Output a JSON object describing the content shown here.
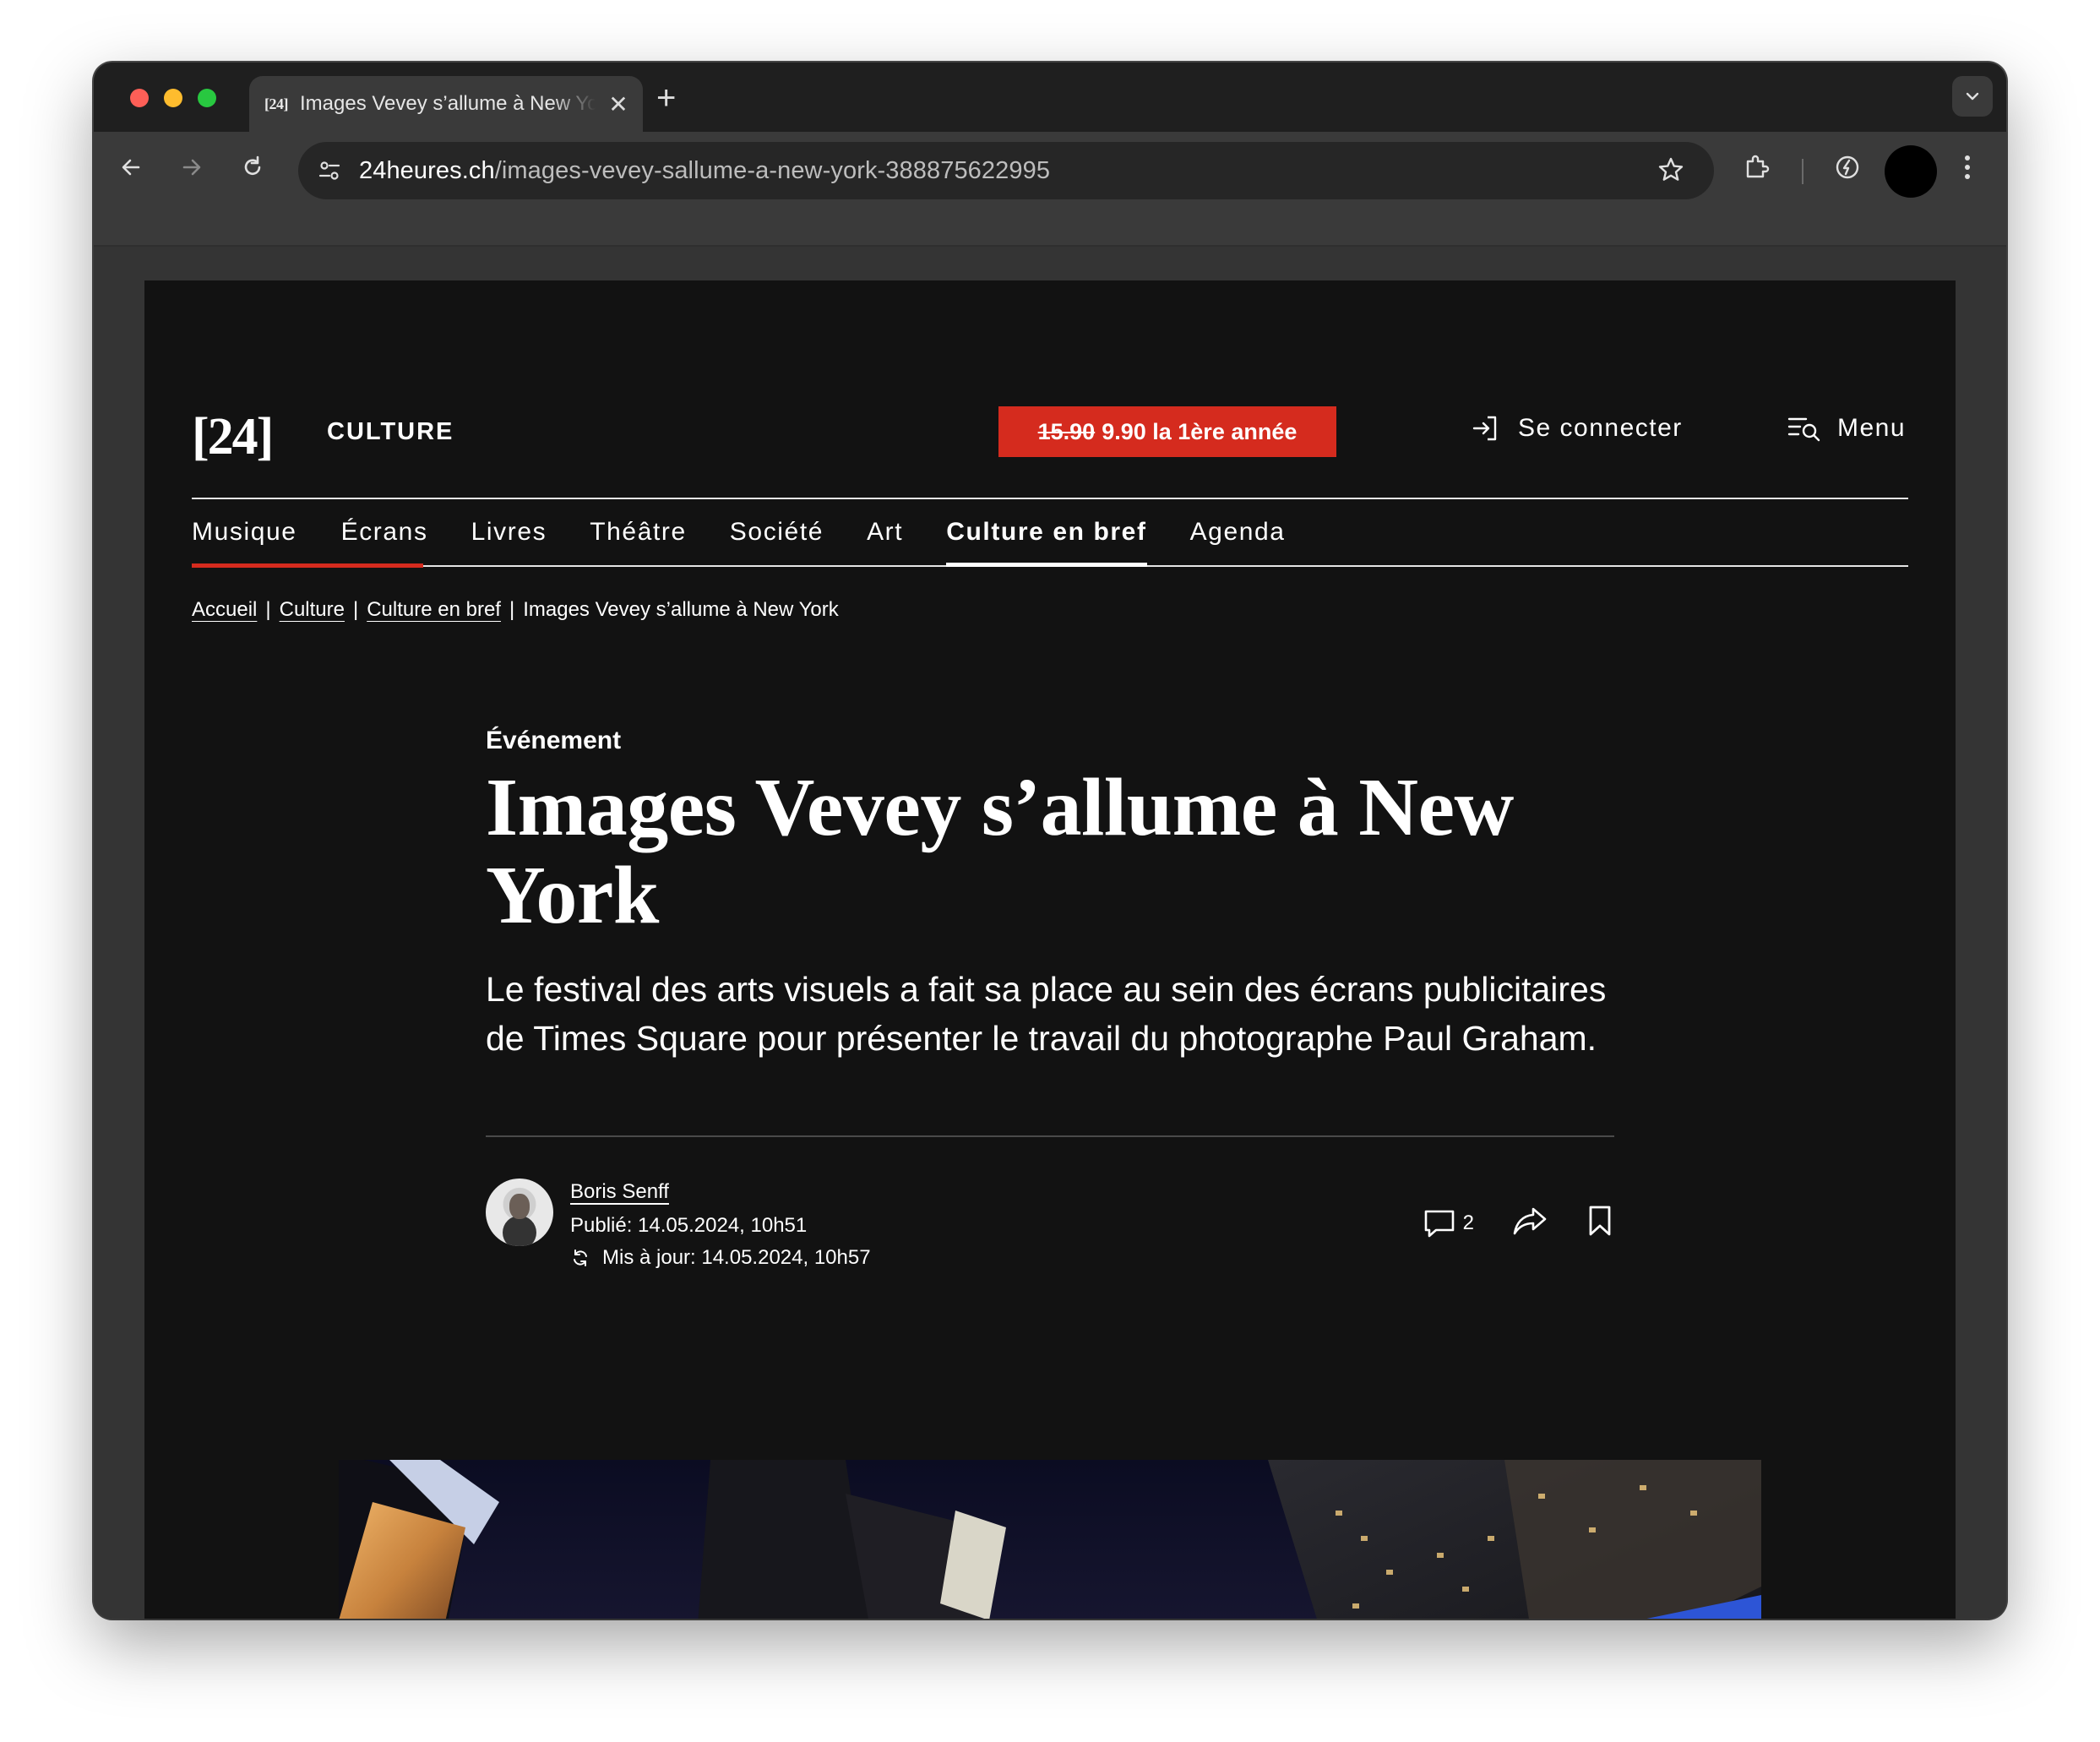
{
  "browser": {
    "tab": {
      "favicon_text": "[24]",
      "title": "Images Vevey s’allume à New York"
    },
    "url": {
      "host": "24heures.ch",
      "path": "/images-vevey-sallume-a-new-york-388875622995"
    }
  },
  "site": {
    "logo": "[24]",
    "section": "CULTURE",
    "promo": {
      "old_price": "15.90",
      "new_text": "9.90 la 1ère année"
    },
    "login_label": "Se connecter",
    "menu_label": "Menu",
    "nav": [
      "Musique",
      "Écrans",
      "Livres",
      "Théâtre",
      "Société",
      "Art",
      "Culture en bref",
      "Agenda"
    ],
    "nav_active": "Culture en bref",
    "breadcrumb": [
      "Accueil",
      "Culture",
      "Culture en bref",
      "Images Vevey s’allume à New York"
    ]
  },
  "article": {
    "kicker": "Événement",
    "headline": "Images Vevey s’allume à New York",
    "lead": "Le festival des arts visuels a fait sa place au sein des écrans publicitaires de Times Square pour présenter le travail du photographe Paul Graham.",
    "author": "Boris Senff",
    "published": "Publié: 14.05.2024, 10h51",
    "updated": "Mis à jour: 14.05.2024, 10h57",
    "comment_count": "2"
  },
  "colors": {
    "accent": "#d52b1e",
    "page_bg": "#121212",
    "text": "#ffffff"
  }
}
